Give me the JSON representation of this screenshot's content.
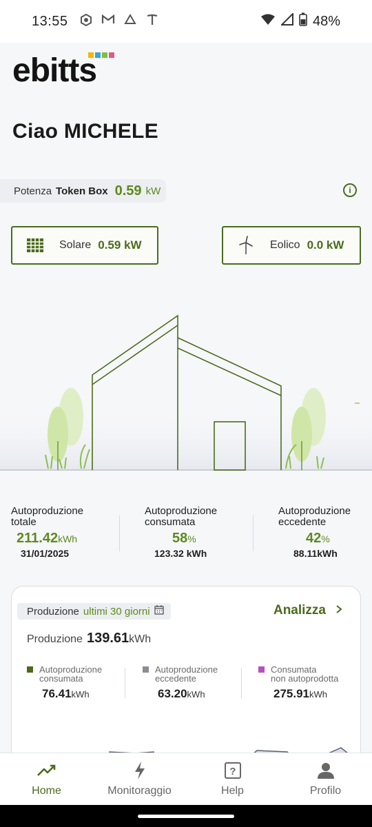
{
  "status_bar": {
    "time": "13:55",
    "battery": "48%"
  },
  "app": {
    "logo_text": "ebitts"
  },
  "greeting": "Ciao MICHELE",
  "power": {
    "label_prefix": "Potenza",
    "label_strong": "Token Box",
    "value": "0.59",
    "unit": "kW"
  },
  "sources": {
    "solar": {
      "label": "Solare",
      "value": "0.59 kW"
    },
    "wind": {
      "label": "Eolico",
      "value": "0.0 kW"
    }
  },
  "stats": [
    {
      "label_line1": "Autoproduzione",
      "label_line2": "totale",
      "value": "211.42",
      "unit": "kWh",
      "sub": "31/01/2025"
    },
    {
      "label_line1": "Autoproduzione",
      "label_line2": "consumata",
      "value": "58",
      "unit": "%",
      "sub": "123.32 kWh"
    },
    {
      "label_line1": "Autoproduzione",
      "label_line2": "eccedente",
      "value": "42",
      "unit": "%",
      "sub": "88.11kWh"
    }
  ],
  "production": {
    "period_prefix": "Produzione",
    "period_value": "ultimi 30 giorni",
    "analyze_label": "Analizza",
    "total_label": "Produzione",
    "total_value": "139.61",
    "total_unit": "kWh",
    "legend": [
      {
        "line1": "Autoproduzione",
        "line2": "consumata",
        "value": "76.41",
        "unit": "kWh",
        "color": "#4a6b1c"
      },
      {
        "line1": "Autoproduzione",
        "line2": "eccedente",
        "value": "63.20",
        "unit": "kWh",
        "color": "#8a8d92"
      },
      {
        "line1": "Consumata",
        "line2": "non autoprodotta",
        "value": "275.91",
        "unit": "kWh",
        "color": "#b84fc2"
      }
    ]
  },
  "nav": {
    "home": "Home",
    "monitoring": "Monitoraggio",
    "help": "Help",
    "profile": "Profilo"
  },
  "colors": {
    "accent": "#4a6b1c",
    "accent_light": "#5c8a1e"
  }
}
